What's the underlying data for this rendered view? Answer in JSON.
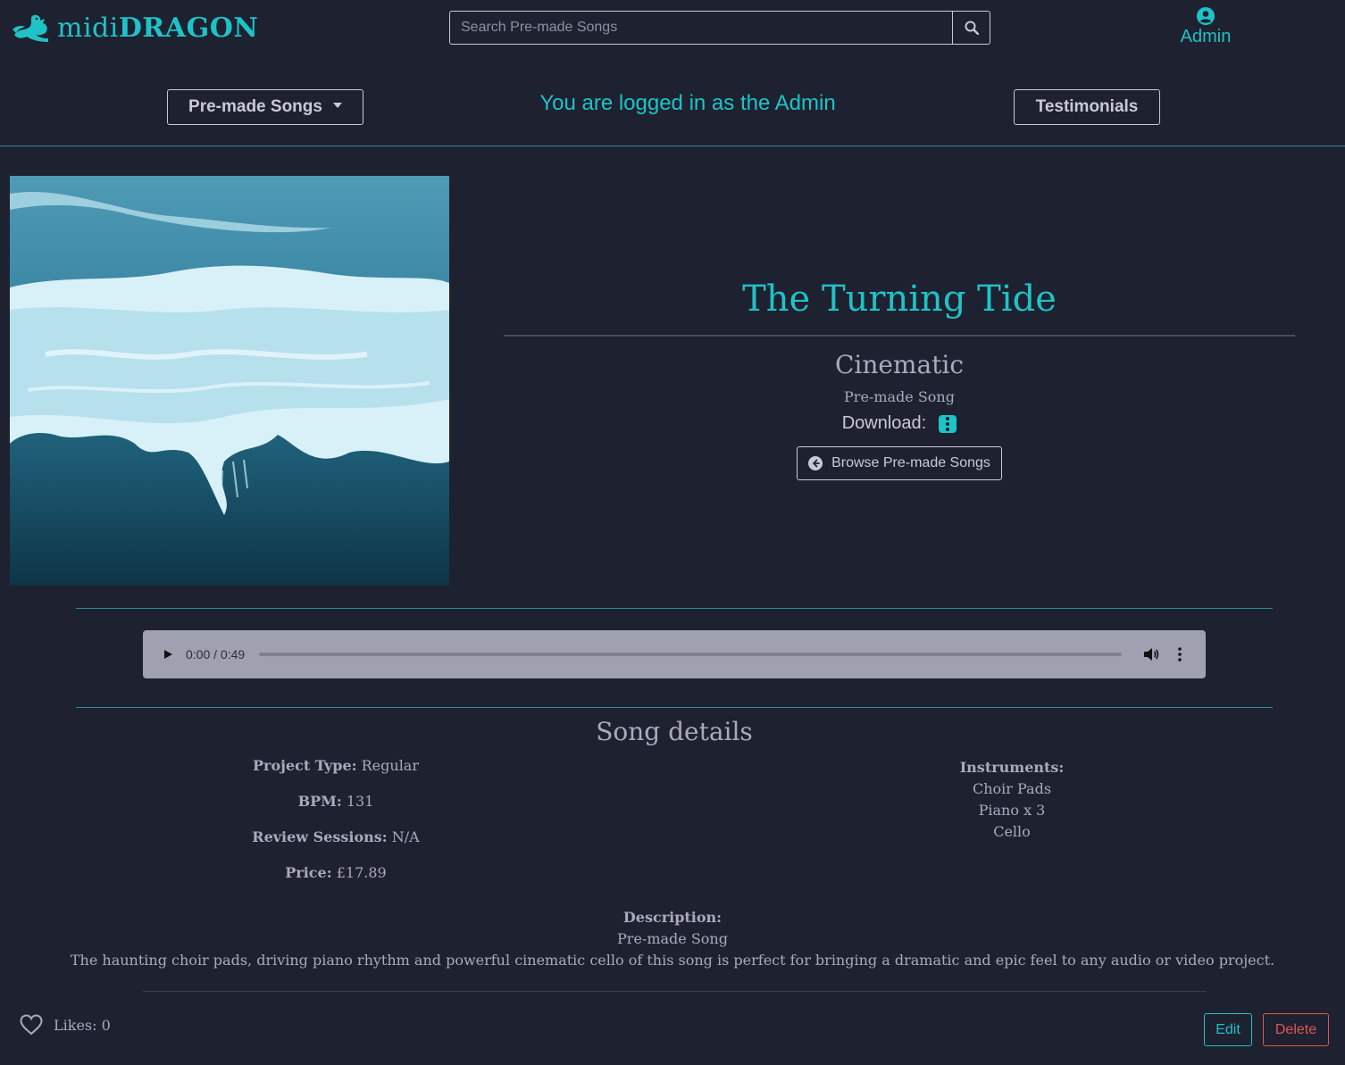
{
  "brand": {
    "name_light": "midi",
    "name_bold": "DRAGON"
  },
  "search": {
    "placeholder": "Search Pre-made Songs",
    "value": ""
  },
  "header": {
    "admin_label": "Admin",
    "premade_dropdown_label": "Pre-made Songs",
    "testimonials_label": "Testimonials",
    "logged_in_message": "You are logged in as the Admin"
  },
  "song": {
    "title": "The Turning Tide",
    "genre": "Cinematic",
    "type": "Pre-made Song",
    "download_label": "Download:",
    "browse_label": "Browse Pre-made Songs"
  },
  "player": {
    "time": "0:00 / 0:49",
    "progress": 0
  },
  "details": {
    "heading": "Song details",
    "project_type_label": "Project Type:",
    "project_type_value": "Regular",
    "bpm_label": "BPM:",
    "bpm_value": "131",
    "review_label": "Review Sessions:",
    "review_value": "N/A",
    "price_label": "Price:",
    "price_value": "£17.89",
    "instruments_label": "Instruments:",
    "instruments": [
      "Choir Pads",
      "Piano x 3",
      "Cello"
    ],
    "description_label": "Description:",
    "description_type": "Pre-made Song",
    "description_text": "The haunting choir pads, driving piano rhythm and powerful cinematic cello of this song is perfect for bringing a dramatic and epic feel to any audio or video project."
  },
  "footer": {
    "likes_label": "Likes:",
    "likes_count": "0",
    "edit_label": "Edit",
    "delete_label": "Delete"
  },
  "colors": {
    "background": "#1e2130",
    "accent": "#1ec3c8",
    "text": "#a9abbd",
    "danger": "#e05656"
  },
  "icons": [
    "dragon-logo-icon",
    "search-icon",
    "user-circle-icon",
    "chevron-down-icon",
    "download-menu-icon",
    "arrow-left-circle-icon",
    "play-icon",
    "volume-icon",
    "more-vertical-icon",
    "heart-icon"
  ]
}
